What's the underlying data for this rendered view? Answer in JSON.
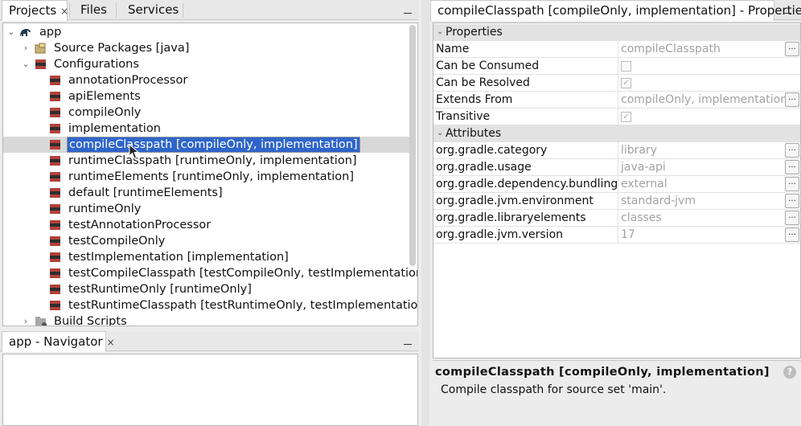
{
  "left_tabs": [
    {
      "label": "Projects"
    },
    {
      "label": "Files"
    },
    {
      "label": "Services"
    }
  ],
  "project_tree": {
    "root": "app",
    "source_packages": "Source Packages [java]",
    "configurations": "Configurations",
    "items": [
      "annotationProcessor",
      "apiElements",
      "compileOnly",
      "implementation",
      "compileClasspath [compileOnly, implementation]",
      "runtimeClasspath [runtimeOnly, implementation]",
      "runtimeElements [runtimeOnly, implementation]",
      "default [runtimeElements]",
      "runtimeOnly",
      "testAnnotationProcessor",
      "testCompileOnly",
      "testImplementation [implementation]",
      "testCompileClasspath [testCompileOnly, testImplementation]",
      "testRuntimeOnly [runtimeOnly]",
      "testRuntimeClasspath [testRuntimeOnly, testImplementation]"
    ],
    "selected_index": 4,
    "build_scripts": "Build Scripts"
  },
  "navigator": {
    "tab_label": "app - Navigator"
  },
  "properties": {
    "tab_label": "compileClasspath [compileOnly, implementation] - Properties",
    "category_properties": "Properties",
    "category_attributes": "Attributes",
    "rows": [
      {
        "name": "Name",
        "value": "compileClasspath",
        "kind": "text",
        "button": true
      },
      {
        "name": "Can be Consumed",
        "value": "",
        "kind": "checkbox",
        "checked": false,
        "button": false
      },
      {
        "name": "Can be Resolved",
        "value": "",
        "kind": "checkbox",
        "checked": true,
        "button": false
      },
      {
        "name": "Extends From",
        "value": "compileOnly, implementation",
        "kind": "text",
        "button": true
      },
      {
        "name": "Transitive",
        "value": "",
        "kind": "checkbox",
        "checked": true,
        "button": false
      }
    ],
    "attributes": [
      {
        "name": "org.gradle.category",
        "value": "library"
      },
      {
        "name": "org.gradle.usage",
        "value": "java-api"
      },
      {
        "name": "org.gradle.dependency.bundling",
        "value": "external"
      },
      {
        "name": "org.gradle.jvm.environment",
        "value": "standard-jvm"
      },
      {
        "name": "org.gradle.libraryelements",
        "value": "classes"
      },
      {
        "name": "org.gradle.jvm.version",
        "value": "17"
      }
    ],
    "button_label": "...",
    "description_title": "compileClasspath [compileOnly, implementation]",
    "description_text": "Compile classpath for source set 'main'.",
    "help_label": "?"
  },
  "close_glyph": "×",
  "minimize_glyph": "—"
}
